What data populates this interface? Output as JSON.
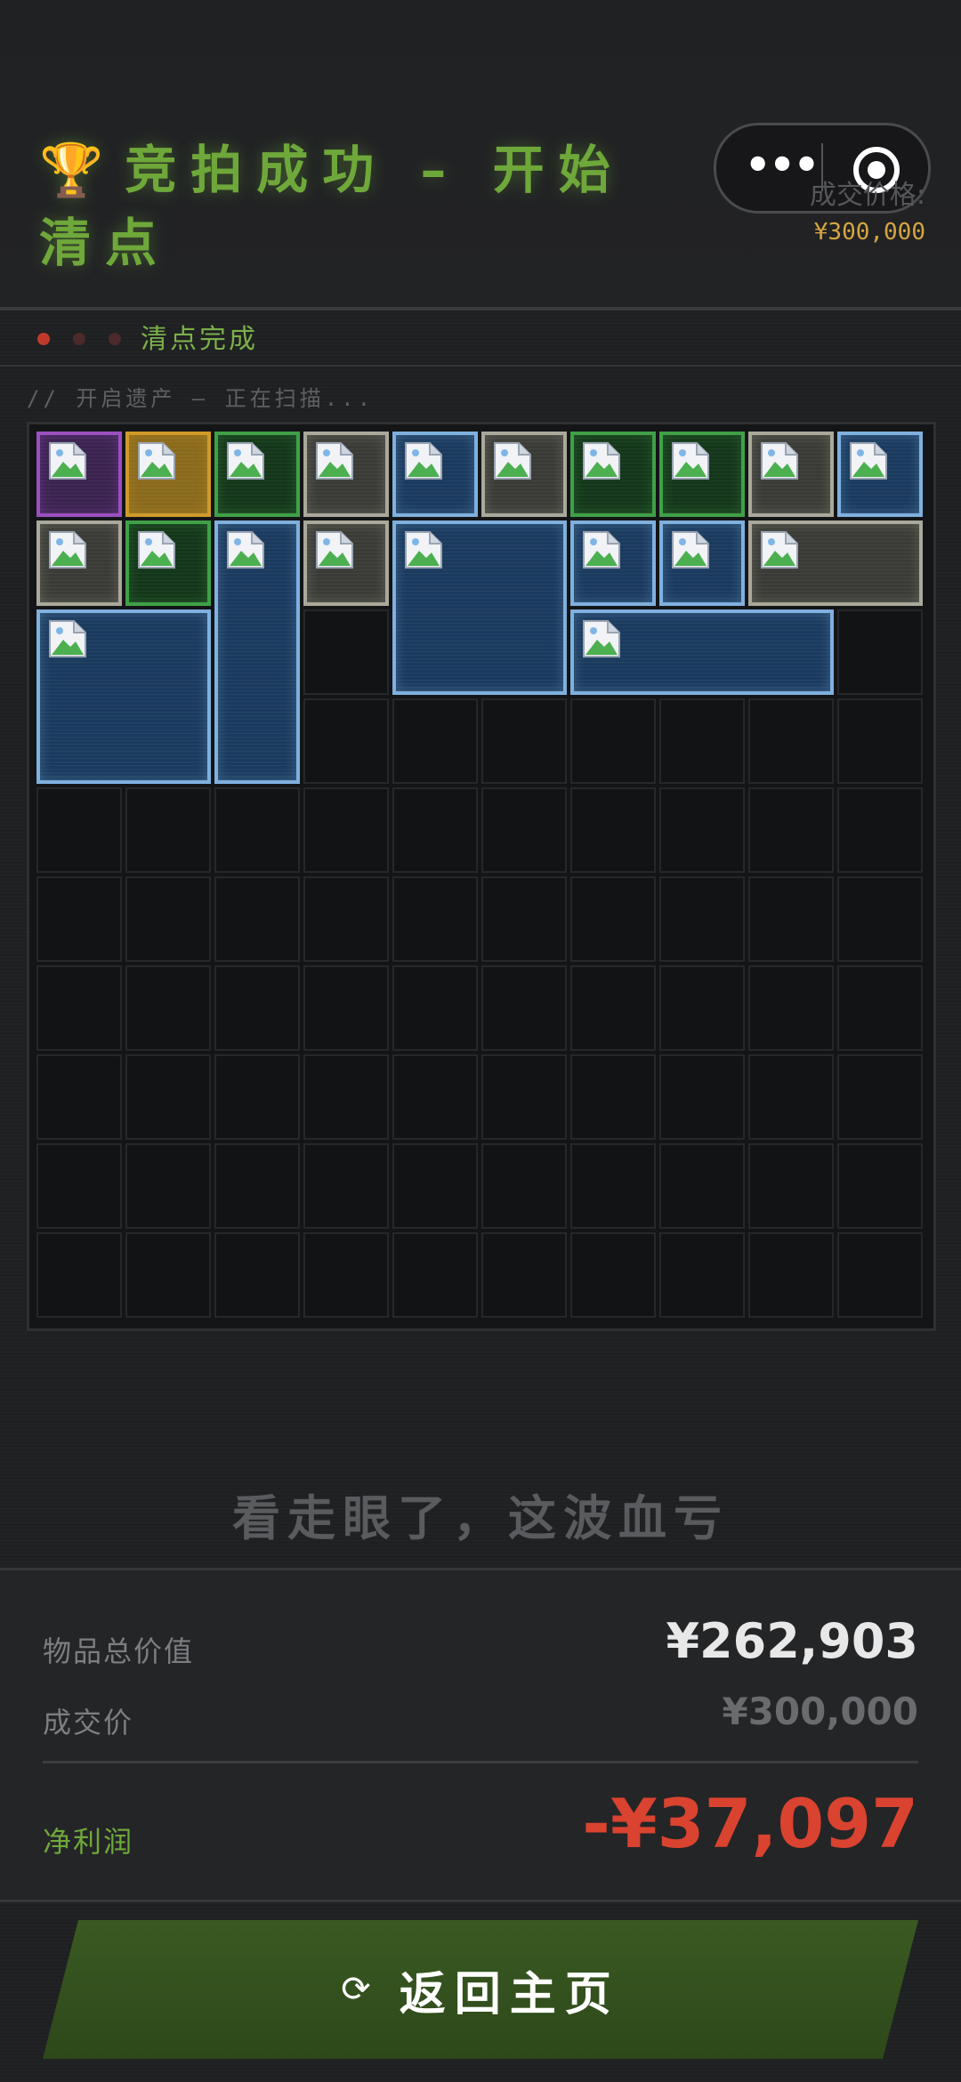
{
  "header": {
    "trophy_icon": "🏆",
    "title": "竞拍成功 – 开始清点",
    "price_label": "成交价格:",
    "price_value": "¥300,000",
    "menu_icon": "more-dots-icon",
    "close_icon": "target-circle-icon"
  },
  "status": {
    "text": "清点完成",
    "dot_colors": [
      "#c0392b",
      "#4a2a2a",
      "#4a2a2a"
    ]
  },
  "scan": {
    "text": "// 开启遗产 – 正在扫描..."
  },
  "grid": {
    "cols": 10,
    "rows": 10,
    "rarity_colors": {
      "purple": {
        "border": "#9b4fc0",
        "fill": "#3b2350"
      },
      "gold": {
        "border": "#d09a2a",
        "fill": "#8a6a1c"
      },
      "green": {
        "border": "#3fa048",
        "fill": "#14361a"
      },
      "gray": {
        "border": "#a9a89a",
        "fill": "#3a3b36"
      },
      "blue": {
        "border": "#7fb0de",
        "fill": "#1a3a5e"
      }
    },
    "items": [
      {
        "rarity": "purple",
        "col": 0,
        "row": 0,
        "w": 1,
        "h": 1
      },
      {
        "rarity": "gold",
        "col": 1,
        "row": 0,
        "w": 1,
        "h": 1
      },
      {
        "rarity": "green",
        "col": 2,
        "row": 0,
        "w": 1,
        "h": 1
      },
      {
        "rarity": "gray",
        "col": 3,
        "row": 0,
        "w": 1,
        "h": 1
      },
      {
        "rarity": "blue",
        "col": 4,
        "row": 0,
        "w": 1,
        "h": 1
      },
      {
        "rarity": "gray",
        "col": 5,
        "row": 0,
        "w": 1,
        "h": 1
      },
      {
        "rarity": "green",
        "col": 6,
        "row": 0,
        "w": 1,
        "h": 1
      },
      {
        "rarity": "green",
        "col": 7,
        "row": 0,
        "w": 1,
        "h": 1
      },
      {
        "rarity": "gray",
        "col": 8,
        "row": 0,
        "w": 1,
        "h": 1
      },
      {
        "rarity": "blue",
        "col": 9,
        "row": 0,
        "w": 1,
        "h": 1
      },
      {
        "rarity": "gray",
        "col": 0,
        "row": 1,
        "w": 1,
        "h": 1
      },
      {
        "rarity": "green",
        "col": 1,
        "row": 1,
        "w": 1,
        "h": 1
      },
      {
        "rarity": "blue",
        "col": 2,
        "row": 1,
        "w": 1,
        "h": 3
      },
      {
        "rarity": "gray",
        "col": 3,
        "row": 1,
        "w": 1,
        "h": 1
      },
      {
        "rarity": "blue",
        "col": 4,
        "row": 1,
        "w": 2,
        "h": 2
      },
      {
        "rarity": "blue",
        "col": 6,
        "row": 1,
        "w": 1,
        "h": 1
      },
      {
        "rarity": "blue",
        "col": 7,
        "row": 1,
        "w": 1,
        "h": 1
      },
      {
        "rarity": "gray",
        "col": 8,
        "row": 1,
        "w": 2,
        "h": 1
      },
      {
        "rarity": "blue",
        "col": 0,
        "row": 2,
        "w": 2,
        "h": 2
      },
      {
        "rarity": "blue",
        "col": 6,
        "row": 2,
        "w": 3,
        "h": 1
      }
    ]
  },
  "verdict": "看走眼了，这波血亏",
  "summary": {
    "total_label": "物品总价值",
    "total_value": "¥262,903",
    "deal_label": "成交价",
    "deal_value": "¥300,000",
    "profit_label": "净利润",
    "profit_value": "-¥37,097",
    "colors": {
      "total": "#e8e8e8",
      "deal": "#6a6b6e",
      "profit_label": "#6fa83a",
      "profit_value": "#d9432f"
    }
  },
  "button": {
    "icon": "⟳",
    "label": "返回主页"
  }
}
